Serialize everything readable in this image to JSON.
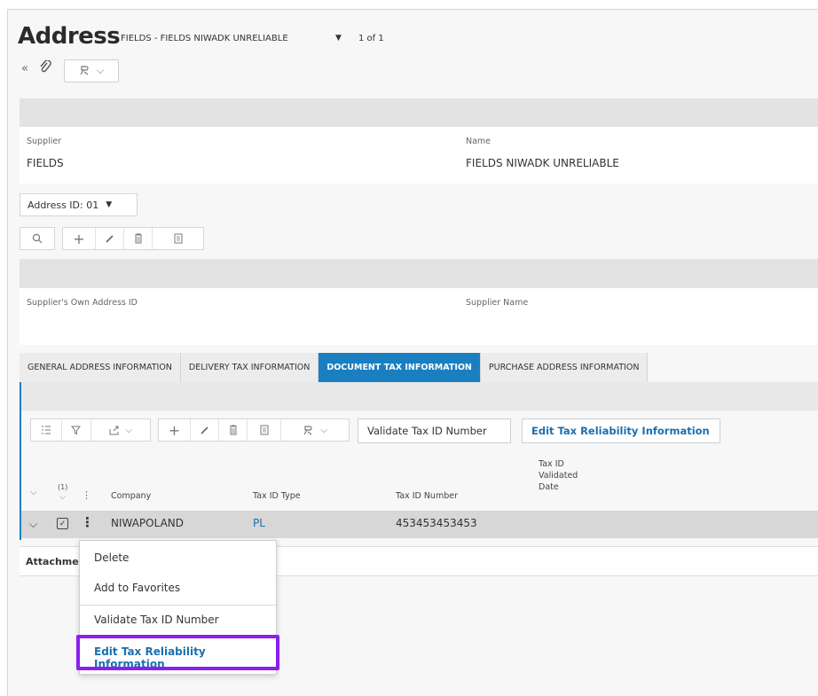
{
  "header": {
    "title": "Address",
    "record_context": "FIELDS - FIELDS NIWADK UNRELIABLE",
    "record_count": "1 of 1"
  },
  "supplier_panel": {
    "supplier_label": "Supplier",
    "supplier_value": "FIELDS",
    "name_label": "Name",
    "name_value": "FIELDS NIWADK UNRELIABLE"
  },
  "address_selector": {
    "label": "Address ID: 01"
  },
  "address_panel": {
    "own_id_label": "Supplier's Own Address ID",
    "supplier_name_label": "Supplier Name"
  },
  "tabs": [
    {
      "label": "GENERAL ADDRESS INFORMATION",
      "active": false
    },
    {
      "label": "DELIVERY TAX INFORMATION",
      "active": false
    },
    {
      "label": "DOCUMENT TAX INFORMATION",
      "active": true
    },
    {
      "label": "PURCHASE ADDRESS INFORMATION",
      "active": false
    }
  ],
  "toolbar": {
    "validate_label": "Validate Tax ID Number",
    "edit_reliability_label": "Edit Tax Reliability Information"
  },
  "table": {
    "selected_count": "(1)",
    "columns": {
      "company": "Company",
      "tax_id_type": "Tax ID Type",
      "tax_id_number": "Tax ID Number",
      "validated_date_1": "Tax ID",
      "validated_date_2": "Validated",
      "validated_date_3": "Date"
    },
    "rows": [
      {
        "company": "NIWAPOLAND",
        "tax_id_type": "PL",
        "tax_id_number": "453453453453"
      }
    ]
  },
  "attachments_label": "Attachme",
  "context_menu": {
    "items": [
      "Delete",
      "Add to Favorites",
      "Validate Tax ID Number",
      "Edit Tax Reliability Information"
    ]
  },
  "colors": {
    "accent": "#1a7fc0",
    "highlight": "#8a1ff0",
    "link": "#1a6fb0"
  }
}
